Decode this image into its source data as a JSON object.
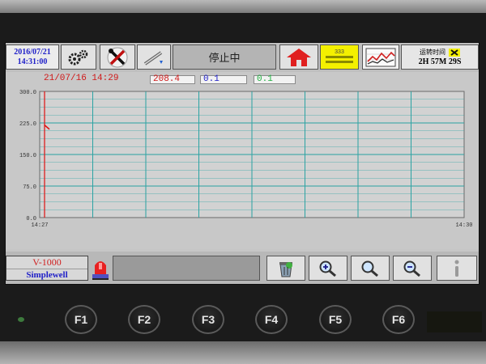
{
  "device": {
    "model": "V-1000",
    "brand": "Simplewell"
  },
  "header": {
    "date": "2016/07/21",
    "time": "14:31:00",
    "status": "停止中",
    "trend_icon_label": "333",
    "timer_label": "运转时间",
    "timer_value": "2H 57M 29S"
  },
  "trend": {
    "date_time": "21/07/16 14:29",
    "value1": "208.4",
    "value2": "0.1",
    "value3": "0.1"
  },
  "function_keys": [
    "F1",
    "F2",
    "F3",
    "F4",
    "F5",
    "F6"
  ],
  "scroll": {
    "left": "◀",
    "right": "▶"
  },
  "colors": {
    "plot_bg": "#d2d2d2",
    "grid": "#2ba3a3",
    "series1": "#e01010",
    "datetime_text": "#1e1ec8",
    "home_icon": "#e02020",
    "status_bg": "#b4b4b4"
  },
  "chart_data": {
    "type": "line",
    "title": "",
    "xlabel": "",
    "ylabel": "",
    "x_ticks": [
      "14:27",
      "14:30"
    ],
    "y_ticks": [
      "0.0",
      "75.0",
      "150.0",
      "225.0",
      "300.0"
    ],
    "ylim": [
      0,
      300
    ],
    "xlim": [
      "14:27",
      "14:30"
    ],
    "grid": true,
    "series": [
      {
        "color": "#e01010",
        "points": [
          [
            "14:27",
            220
          ],
          [
            "14:27",
            210
          ]
        ]
      }
    ]
  }
}
